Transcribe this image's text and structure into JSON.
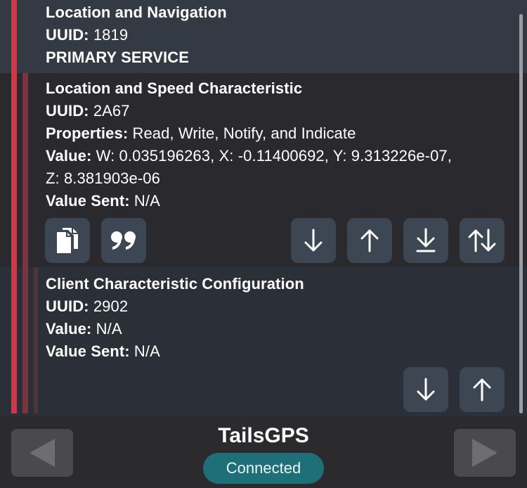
{
  "service": {
    "name": "Location and Navigation",
    "uuid_label": "UUID:",
    "uuid": "1819",
    "type": "PRIMARY SERVICE"
  },
  "characteristic": {
    "name": "Location and Speed Characteristic",
    "uuid_label": "UUID:",
    "uuid": "2A67",
    "properties_label": "Properties:",
    "properties": "Read, Write, Notify, and Indicate",
    "value_label": "Value:",
    "value_line1": "W: 0.035196263, X: -0.11400692, Y: 9.313226e-07,",
    "value_line2": "Z: 8.381903e-06",
    "value_sent_label": "Value Sent:",
    "value_sent": "N/A",
    "actions": [
      "copy-icon",
      "quote-icon",
      "arrow-down-icon",
      "arrow-up-icon",
      "download-icon",
      "arrows-up-down-icon"
    ]
  },
  "descriptor": {
    "name": "Client Characteristic Configuration",
    "uuid_label": "UUID:",
    "uuid": "2902",
    "value_label": "Value:",
    "value": "N/A",
    "value_sent_label": "Value Sent:",
    "value_sent": "N/A",
    "actions": [
      "arrow-down-icon",
      "arrow-up-icon"
    ]
  },
  "footer": {
    "device_name": "TailsGPS",
    "status": "Connected",
    "prev_icon": "triangle-left-icon",
    "next_icon": "triangle-right-icon"
  },
  "colors": {
    "accent_red": "#c93a4b",
    "button_bg": "#3d4753",
    "status_bg": "#1f6f78"
  }
}
